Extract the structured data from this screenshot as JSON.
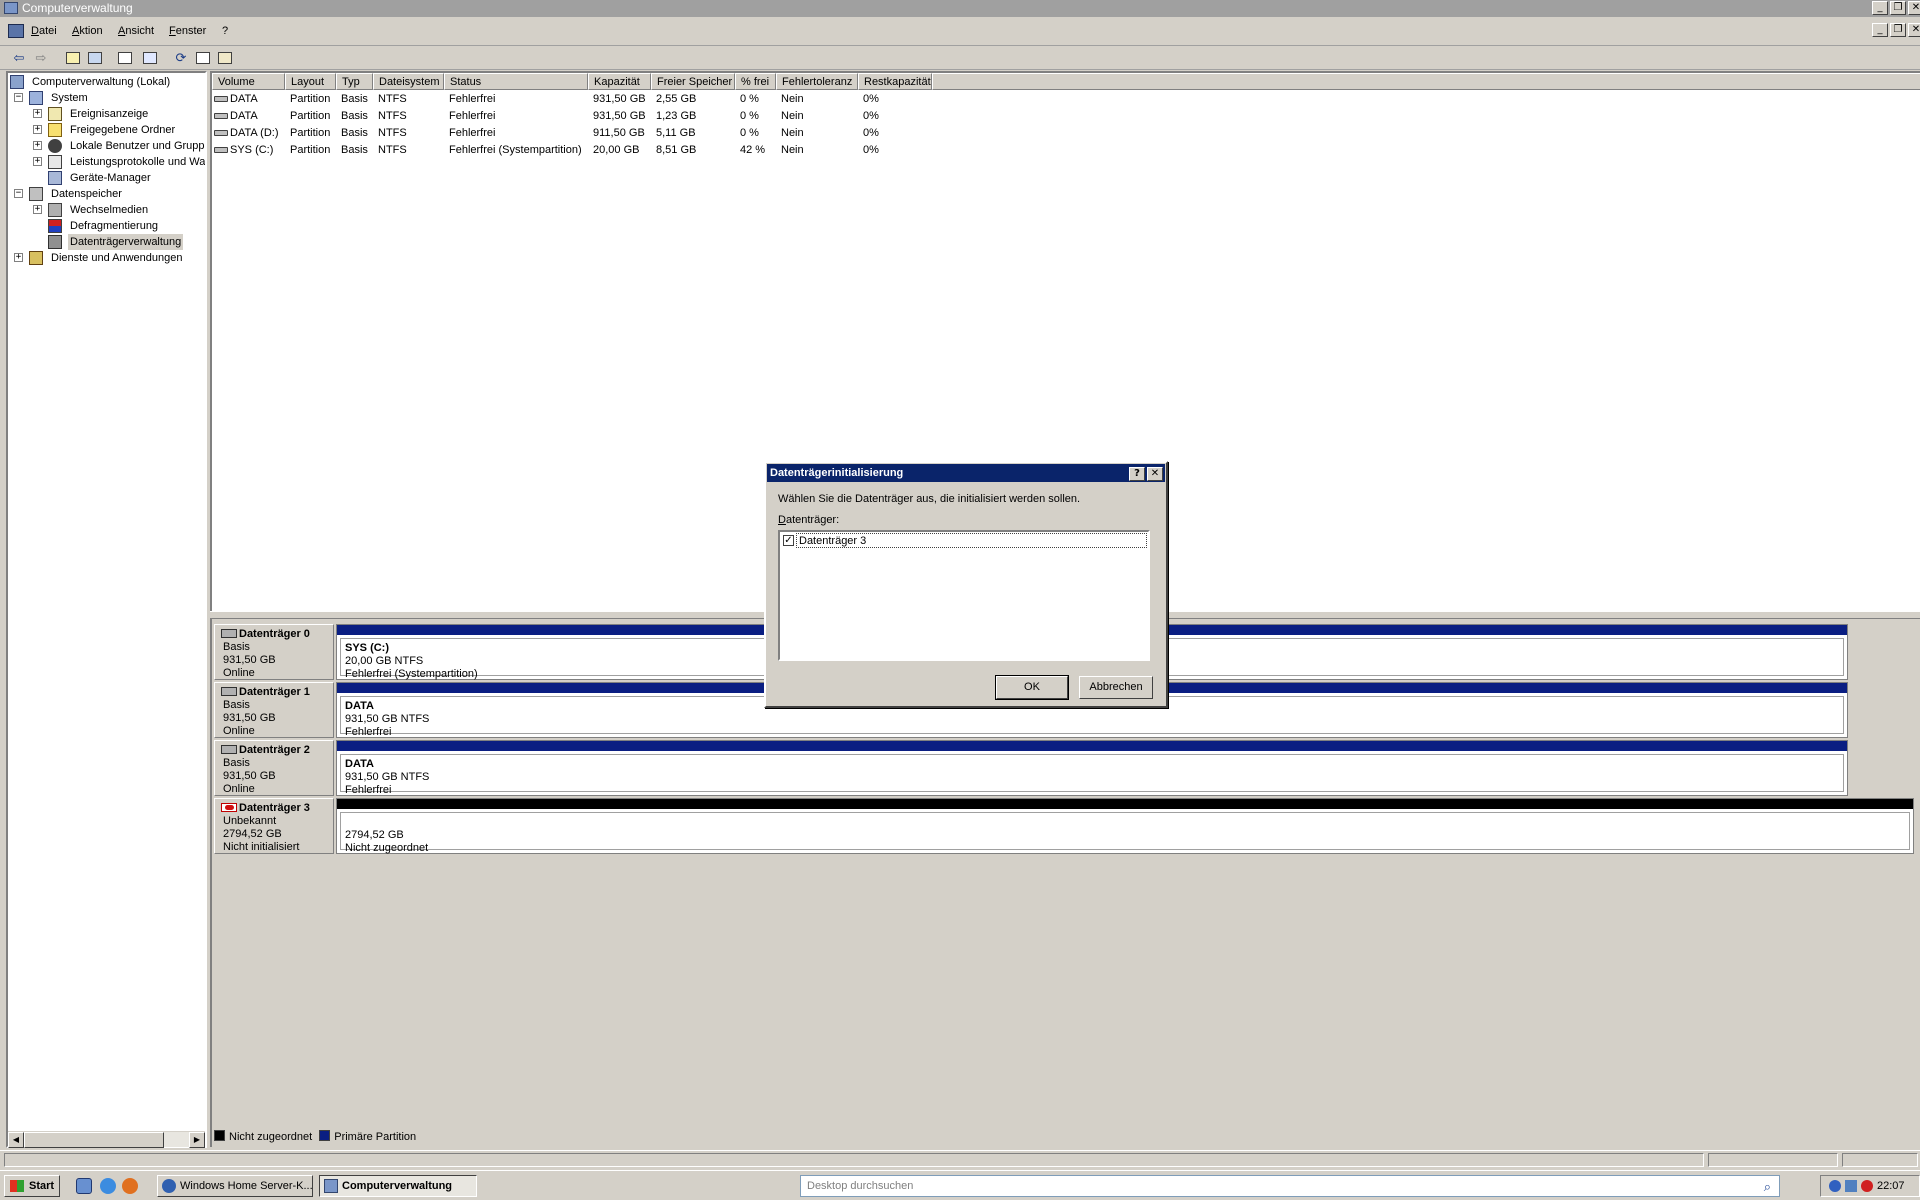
{
  "window": {
    "title": "Computerverwaltung"
  },
  "menubar": {
    "items": [
      {
        "label": "Datei",
        "u": "D",
        "rest": "atei"
      },
      {
        "label": "Aktion",
        "u": "A",
        "rest": "ktion"
      },
      {
        "label": "Ansicht",
        "u": "A",
        "rest": "nsicht"
      },
      {
        "label": "Fenster",
        "u": "F",
        "rest": "enster"
      },
      {
        "label": "?",
        "u": "?",
        "rest": ""
      }
    ]
  },
  "toolbar": {
    "icons": [
      "back-arrow-icon",
      "forward-arrow-icon",
      "up-folder-icon",
      "show-hide-tree-icon",
      "properties-icon",
      "help-icon",
      "refresh-icon",
      "export-list-icon",
      "settings-icon"
    ]
  },
  "tree": {
    "items": [
      {
        "label": "Computerverwaltung (Lokal)",
        "level": 0,
        "expander": ""
      },
      {
        "label": "System",
        "level": 1,
        "expander": "−"
      },
      {
        "label": "Ereignisanzeige",
        "level": 2,
        "expander": "+"
      },
      {
        "label": "Freigegebene Ordner",
        "level": 2,
        "expander": "+"
      },
      {
        "label": "Lokale Benutzer und Gruppe",
        "level": 2,
        "expander": "+"
      },
      {
        "label": "Leistungsprotokolle und War",
        "level": 2,
        "expander": "+"
      },
      {
        "label": "Geräte-Manager",
        "level": 2,
        "expander": ""
      },
      {
        "label": "Datenspeicher",
        "level": 1,
        "expander": "−"
      },
      {
        "label": "Wechselmedien",
        "level": 2,
        "expander": "+"
      },
      {
        "label": "Defragmentierung",
        "level": 2,
        "expander": ""
      },
      {
        "label": "Datenträgerverwaltung",
        "level": 2,
        "expander": "",
        "selected": true
      },
      {
        "label": "Dienste und Anwendungen",
        "level": 1,
        "expander": "+"
      }
    ]
  },
  "volume_list": {
    "columns": [
      "Volume",
      "Layout",
      "Typ",
      "Dateisystem",
      "Status",
      "Kapazität",
      "Freier Speicher",
      "% frei",
      "Fehlertoleranz",
      "Restkapazität"
    ],
    "rows": [
      [
        "DATA",
        "Partition",
        "Basis",
        "NTFS",
        "Fehlerfrei",
        "931,50 GB",
        "2,55 GB",
        "0 %",
        "Nein",
        "0%"
      ],
      [
        "DATA",
        "Partition",
        "Basis",
        "NTFS",
        "Fehlerfrei",
        "931,50 GB",
        "1,23 GB",
        "0 %",
        "Nein",
        "0%"
      ],
      [
        "DATA (D:)",
        "Partition",
        "Basis",
        "NTFS",
        "Fehlerfrei",
        "911,50 GB",
        "5,11 GB",
        "0 %",
        "Nein",
        "0%"
      ],
      [
        "SYS (C:)",
        "Partition",
        "Basis",
        "NTFS",
        "Fehlerfrei (Systempartition)",
        "20,00 GB",
        "8,51 GB",
        "42 %",
        "Nein",
        "0%"
      ]
    ]
  },
  "disks": [
    {
      "name": "Datenträger 0",
      "type": "Basis",
      "size": "931,50 GB",
      "state": "Online",
      "error": false,
      "partition": {
        "name": "SYS  (C:)",
        "line2": "20,00 GB NTFS",
        "line3": "Fehlerfrei (Systempartition)",
        "kind": "primary"
      }
    },
    {
      "name": "Datenträger 1",
      "type": "Basis",
      "size": "931,50 GB",
      "state": "Online",
      "error": false,
      "partition": {
        "name": "DATA",
        "line2": "931,50 GB NTFS",
        "line3": "Fehlerfrei",
        "kind": "primary"
      }
    },
    {
      "name": "Datenträger 2",
      "type": "Basis",
      "size": "931,50 GB",
      "state": "Online",
      "error": false,
      "partition": {
        "name": "DATA",
        "line2": "931,50 GB NTFS",
        "line3": "Fehlerfrei",
        "kind": "primary"
      }
    },
    {
      "name": "Datenträger 3",
      "type": "Unbekannt",
      "size": "2794,52 GB",
      "state": "Nicht initialisiert",
      "error": true,
      "partition": {
        "name": "",
        "line2": "2794,52 GB",
        "line3": "Nicht zugeordnet",
        "kind": "unallocated"
      }
    }
  ],
  "legend": [
    {
      "label": "Nicht zugeordnet",
      "color": "#000000"
    },
    {
      "label": "Primäre Partition",
      "color": "#0a1e82"
    }
  ],
  "colors": {
    "primary_partition": "#0a1e82",
    "unallocated": "#000000",
    "dialog_title": "#0a246a"
  },
  "dialog": {
    "title": "Datenträgerinitialisierung",
    "help_button": "?",
    "close_button": "✕",
    "prompt": "Wählen Sie die Datenträger aus, die initialisiert werden sollen.",
    "list_label_u": "D",
    "list_label_rest": "atenträger:",
    "items": [
      {
        "label": "Datenträger 3",
        "checked": true
      }
    ],
    "ok_label": "OK",
    "cancel_label": "Abbrechen"
  },
  "taskbar": {
    "start_label": "Start",
    "tasks": [
      {
        "label": "Windows Home Server-K...",
        "active": false
      },
      {
        "label": "Computerverwaltung",
        "active": true
      }
    ],
    "search_placeholder": "Desktop durchsuchen",
    "clock": "22:07"
  }
}
